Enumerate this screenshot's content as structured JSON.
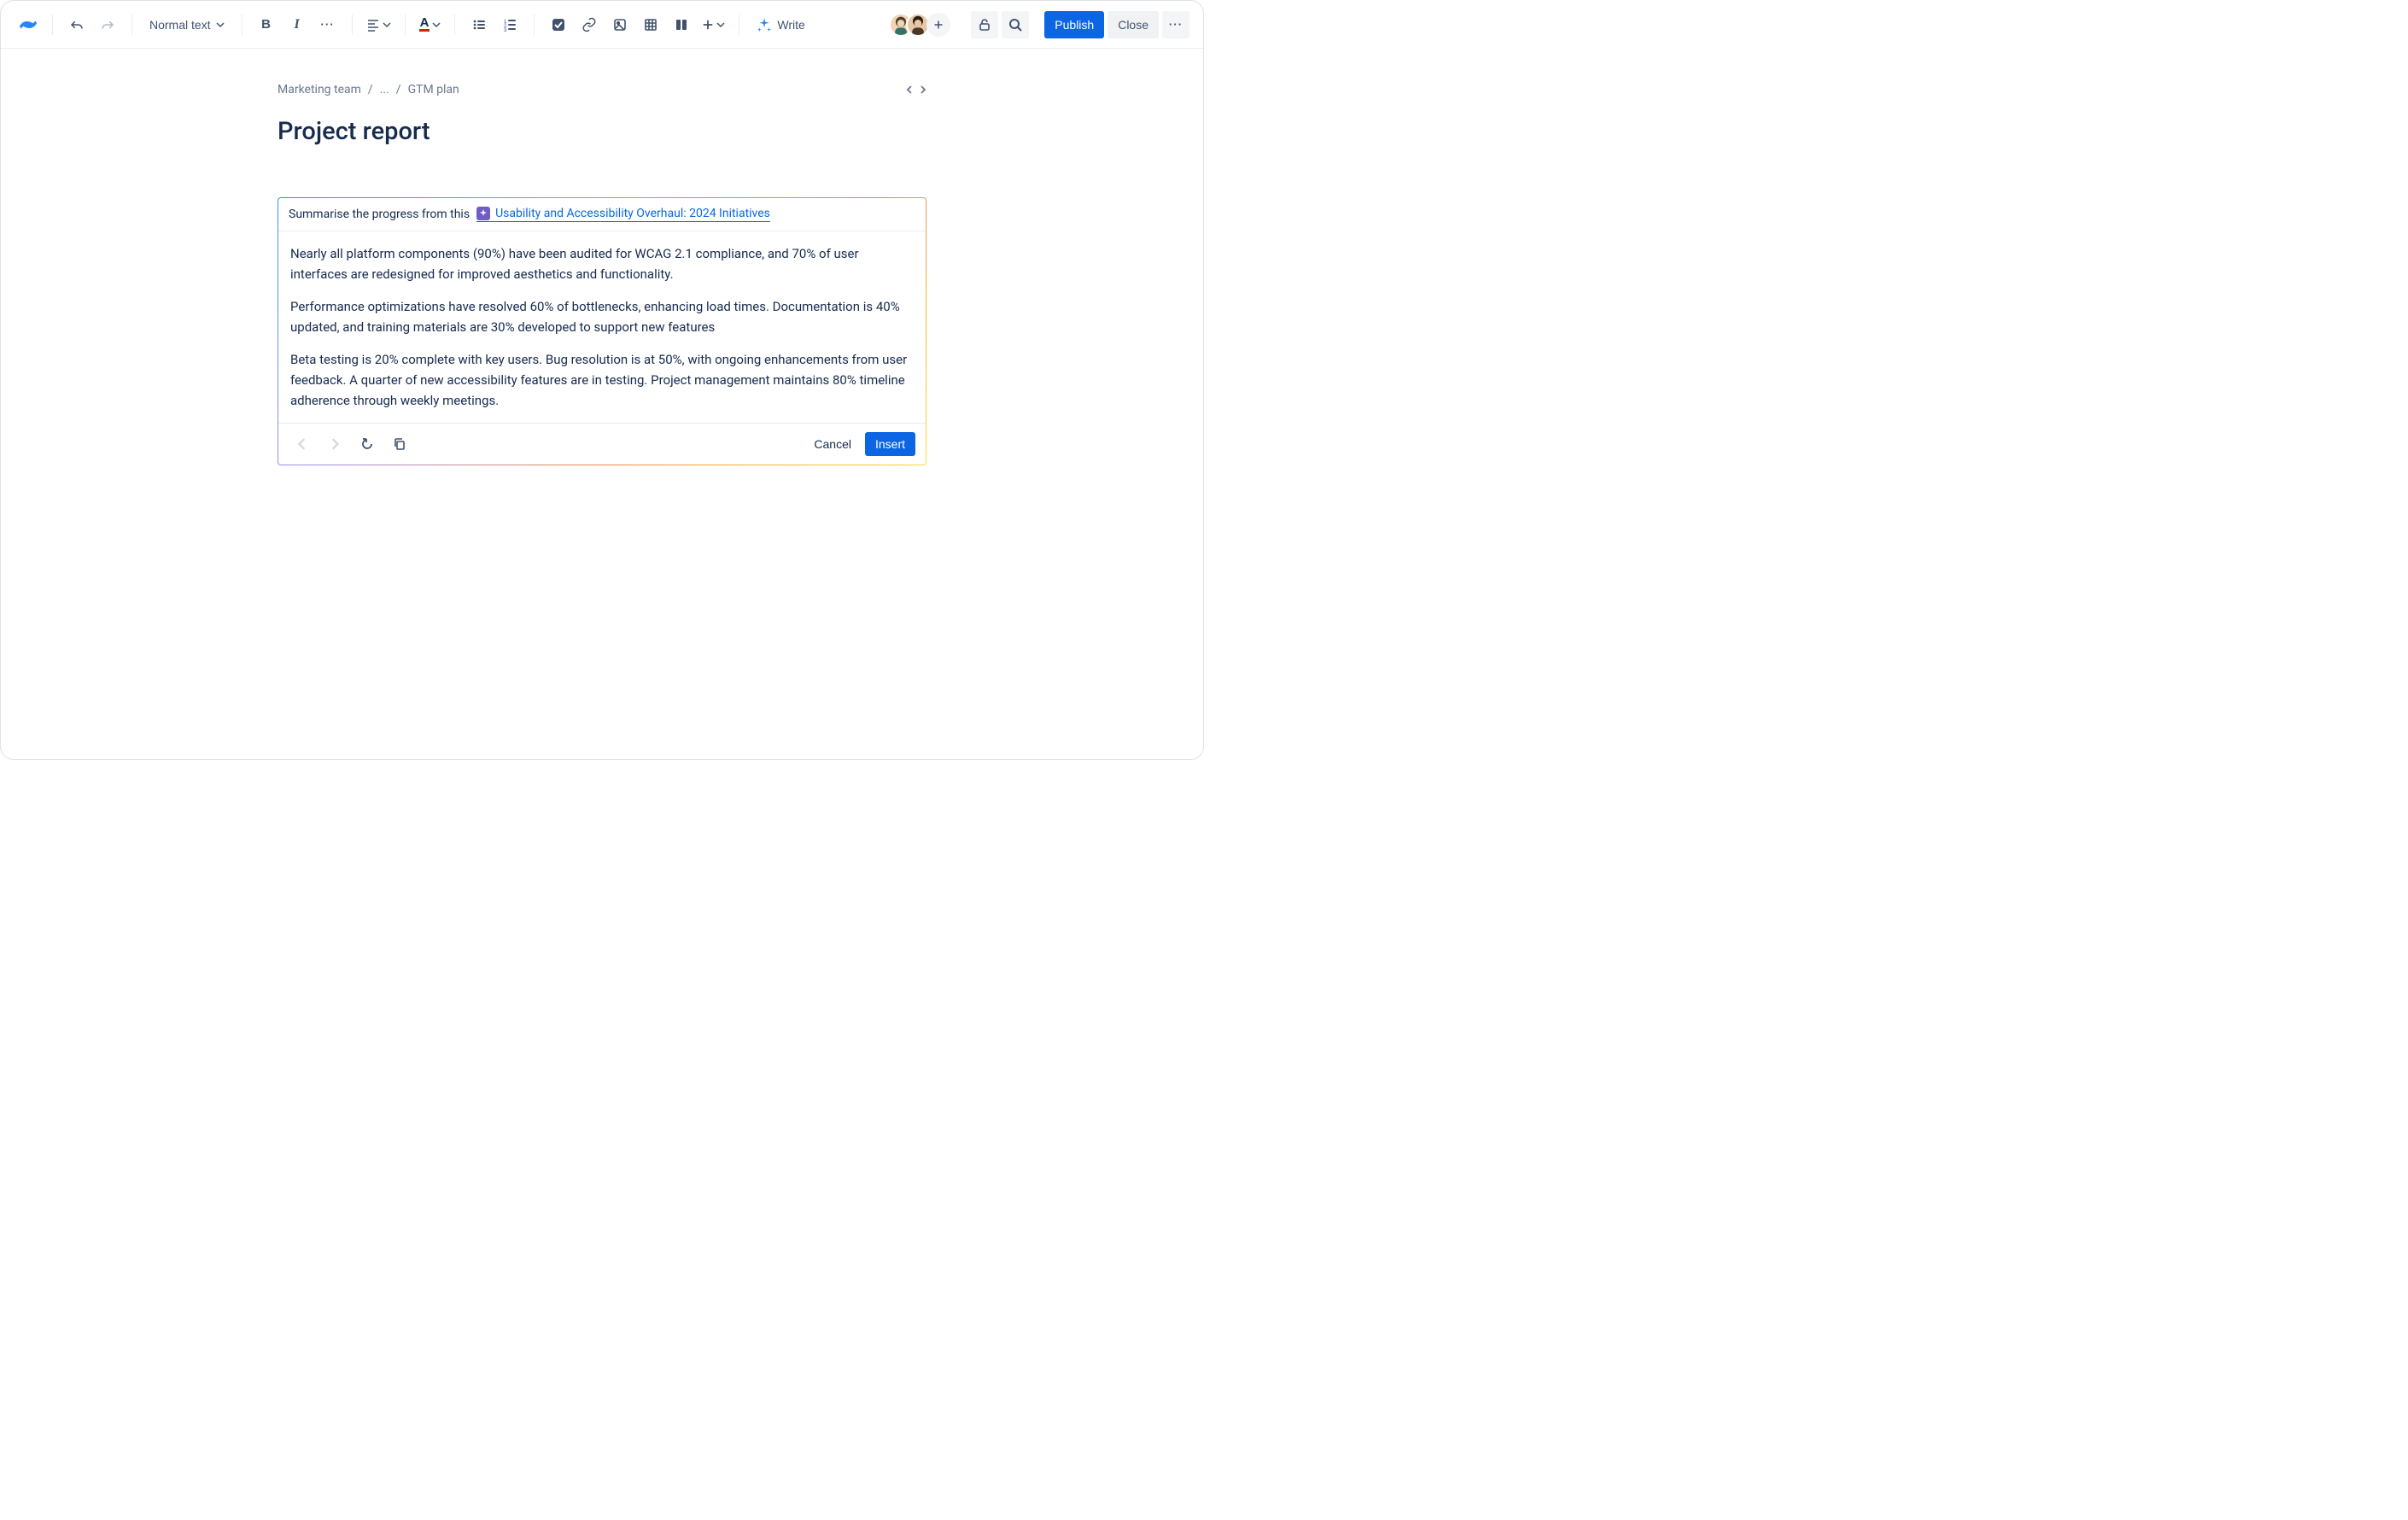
{
  "toolbar": {
    "text_style_label": "Normal text",
    "ai_write_label": "Write",
    "publish_label": "Publish",
    "close_label": "Close"
  },
  "breadcrumbs": {
    "items": [
      "Marketing team",
      "...",
      "GTM plan"
    ]
  },
  "page": {
    "title": "Project report"
  },
  "ai_panel": {
    "prompt_prefix": "Summarise the progress from this",
    "linked_doc_title": "Usability and Accessibility Overhaul: 2024 Initiatives",
    "paragraphs": [
      "Nearly all platform components (90%) have been audited for WCAG 2.1 compliance, and 70% of user interfaces are redesigned for improved aesthetics and functionality.",
      "Performance optimizations have resolved 60% of bottlenecks, enhancing load times. Documentation is 40% updated, and training materials are 30% developed to support new features",
      "Beta testing is 20% complete with key users. Bug resolution is at 50%, with ongoing enhancements from user feedback. A quarter of new accessibility features are in testing. Project management maintains 80% timeline adherence through weekly meetings."
    ],
    "cancel_label": "Cancel",
    "insert_label": "Insert"
  }
}
